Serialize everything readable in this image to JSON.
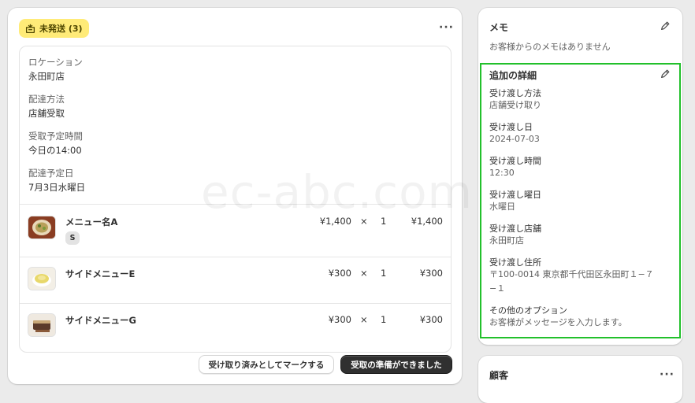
{
  "fulfillment": {
    "badge": "未発送 (3)",
    "badge_icon": "package-icon",
    "fields": [
      {
        "label": "ロケーション",
        "value": "永田町店"
      },
      {
        "label": "配達方法",
        "value": "店舗受取"
      },
      {
        "label": "受取予定時間",
        "value": "今日の14:00"
      },
      {
        "label": "配達予定日",
        "value": "7月3日水曜日"
      }
    ],
    "items": [
      {
        "name": "メニュー名A",
        "variant": "S",
        "price": "¥1,400",
        "times": "×",
        "qty": "1",
        "total": "¥1,400"
      },
      {
        "name": "サイドメニューE",
        "price": "¥300",
        "times": "×",
        "qty": "1",
        "total": "¥300"
      },
      {
        "name": "サイドメニューG",
        "price": "¥300",
        "times": "×",
        "qty": "1",
        "total": "¥300"
      }
    ],
    "mark_picked_up_label": "受け取り済みとしてマークする",
    "ready_for_pickup_label": "受取の準備ができました"
  },
  "memo": {
    "title": "メモ",
    "empty_text": "お客様からのメモはありません"
  },
  "additional_details": {
    "title": "追加の詳細",
    "fields": [
      {
        "label": "受け渡し方法",
        "value": "店舗受け取り"
      },
      {
        "label": "受け渡し日",
        "value": "2024-07-03"
      },
      {
        "label": "受け渡し時間",
        "value": "12:30"
      },
      {
        "label": "受け渡し曜日",
        "value": "水曜日"
      },
      {
        "label": "受け渡し店舗",
        "value": "永田町店"
      },
      {
        "label": "受け渡し住所",
        "value": "〒100-0014 東京都千代田区永田町１−７−１"
      },
      {
        "label": "その他のオプション",
        "value": "お客様がメッセージを入力します。"
      }
    ],
    "highlight_color": "#22c02b"
  },
  "customer": {
    "title": "顧客"
  },
  "watermark": "ec-abc.com",
  "colors": {
    "badge_bg": "#ffeb78",
    "primary_button": "#303030",
    "page_bg": "#ebebeb"
  }
}
